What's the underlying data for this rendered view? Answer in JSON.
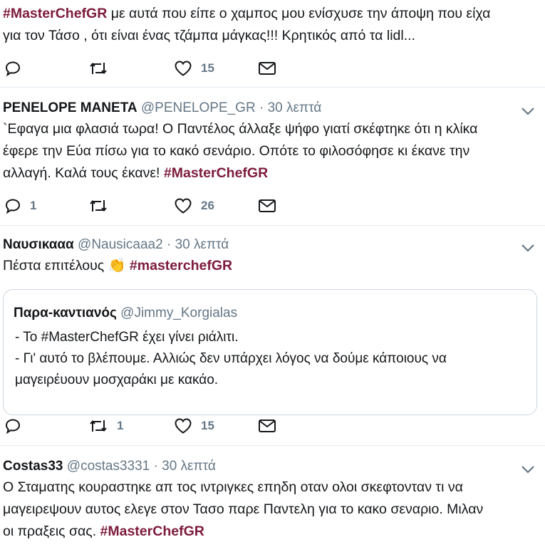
{
  "tweets": [
    {
      "hashtag": "#MasterChefGR",
      "text_line1_rest": " με αυτά που είπε ο χαμπος μου ενίσχυσε την άποψη που είχα",
      "text_line2": "για τον Τάσο , ότι είναι ένας τζάμπα μάγκας!!! Κρητικός από τα lidl...",
      "actions": {
        "reply": "",
        "retweet": "",
        "like": "15"
      }
    },
    {
      "name": "PENELOPE MANETA",
      "handle": "@PENELOPE_GR",
      "dot": "·",
      "time": "30 λεπτά",
      "line1": "`Εφαγα μια φλασιά τωρα! Ο Παντέλος άλλαξε ψήφο γιατί σκέφτηκε ότι η κλίκα",
      "line2": "έφερε την Εύα πίσω για το κακό σενάριο. Οπότε το φιλοσόφησε κι έκανε την",
      "line3_rest": "αλλαγή. Καλά τους έκανε! ",
      "hashtag": "#MasterChefGR",
      "actions": {
        "reply": "1",
        "retweet": "",
        "like": "26"
      }
    },
    {
      "name": "Ναυσικααα",
      "handle": "@Nausicaaa2",
      "dot": "·",
      "time": "30 λεπτά",
      "text_rest": "Πέστα επιτέλους ",
      "hashtag": "#masterchefGR",
      "quote": {
        "name": "Παρα-καντιανός",
        "handle": "@Jimmy_Korgialas",
        "line1": "- Το #MasterChefGR έχει γίνει ριάλιτι.",
        "line2": "- Γι' αυτό το βλέπουμε. Αλλιώς δεν υπάρχει λόγος να δούμε κάποιους να",
        "line3": "μαγειρέυουν μοσχαράκι με κακάο."
      },
      "actions": {
        "reply": "",
        "retweet": "1",
        "like": "15"
      }
    },
    {
      "name": "Costas33",
      "handle": "@costas3331",
      "dot": "·",
      "time": "30 λεπτά",
      "line1": "Ο Σταματης κουραστηκε απ τος ιντριγκες επηδη οταν ολοι σκεφτονταν τι να",
      "line2": "μαγειρεψουν αυτος ελεγε στον Τασο παρε Παντελη για το κακο σεναριο. Μιλαν",
      "line3_rest": "οι πραξεις σας. ",
      "hashtag": "#MasterChefGR"
    }
  ],
  "colors": {
    "hashtag": "#7d1b3b",
    "muted": "#657786",
    "border": "#e6ecf0",
    "quote_border": "#ccd6dd"
  },
  "icons": [
    "reply-icon",
    "retweet-icon",
    "like-icon",
    "message-icon",
    "chevron-down-icon",
    "clapping-hands-icon"
  ]
}
